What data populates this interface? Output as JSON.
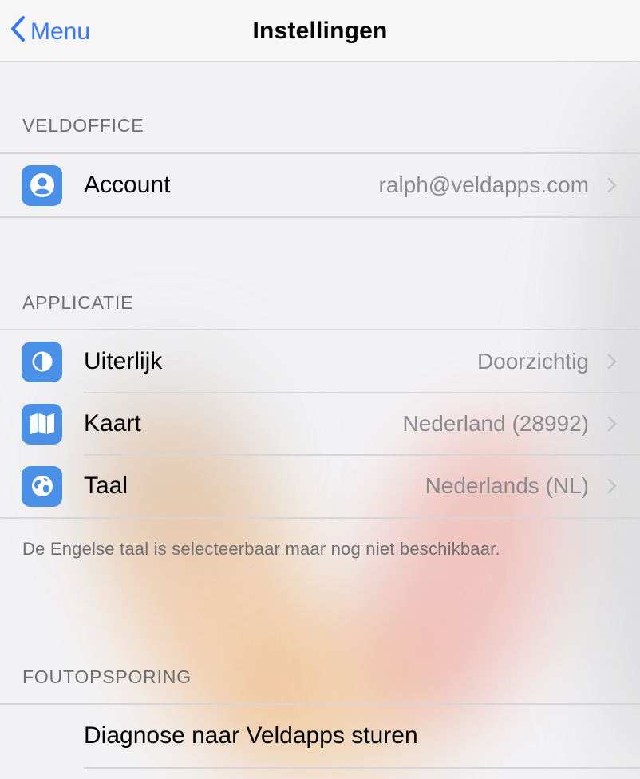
{
  "navbar": {
    "back_label": "Menu",
    "title": "Instellingen"
  },
  "sections": {
    "veldoffice": {
      "header": "VELDOFFICE",
      "account": {
        "label": "Account",
        "value": "ralph@veldapps.com",
        "icon": "person-circle-icon"
      }
    },
    "applicatie": {
      "header": "APPLICATIE",
      "uiterlijk": {
        "label": "Uiterlijk",
        "value": "Doorzichtig",
        "icon": "half-circle-icon"
      },
      "kaart": {
        "label": "Kaart",
        "value": "Nederland (28992)",
        "icon": "map-icon"
      },
      "taal": {
        "label": "Taal",
        "value": "Nederlands (NL)",
        "icon": "globe-icon"
      },
      "footer": "De Engelse taal is selecteerbaar maar nog niet beschikbaar."
    },
    "foutopsporing": {
      "header": "FOUTOPSPORING",
      "diagnose": {
        "label": "Diagnose naar Veldapps sturen"
      }
    }
  },
  "colors": {
    "accent": "#3478f6",
    "icon_bg": "#4a90e6",
    "secondary_text": "#8a8a8f",
    "header_text": "#6d6d72",
    "separator": "#d6d6d8"
  }
}
